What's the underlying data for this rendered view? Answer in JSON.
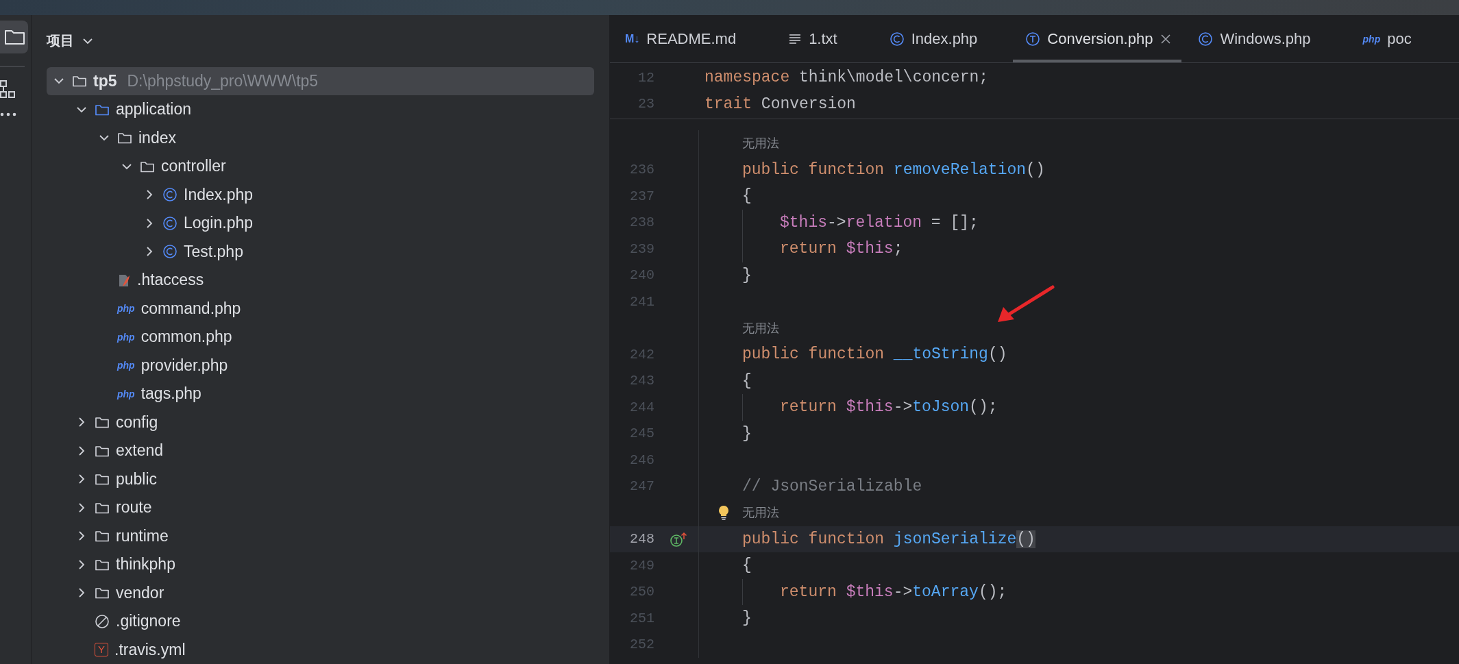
{
  "project_panel": {
    "title": "项目",
    "tree": [
      {
        "name": "tp5",
        "path": "D:\\phpstudy_pro\\WWW\\tp5",
        "kind": "folder",
        "expanded": true,
        "selected": true,
        "children": [
          {
            "name": "application",
            "kind": "source_folder",
            "expanded": true,
            "selected": false,
            "children": [
              {
                "name": "index",
                "kind": "folder",
                "expanded": true,
                "selected": false,
                "children": [
                  {
                    "name": "controller",
                    "kind": "folder",
                    "expanded": true,
                    "selected": false,
                    "children": [
                      {
                        "name": "Index.php",
                        "kind": "class",
                        "expanded": false,
                        "selected": false
                      },
                      {
                        "name": "Login.php",
                        "kind": "class",
                        "expanded": false,
                        "selected": false
                      },
                      {
                        "name": "Test.php",
                        "kind": "class",
                        "expanded": false,
                        "selected": false
                      }
                    ]
                  }
                ]
              },
              {
                "name": ".htaccess",
                "kind": "htaccess",
                "selected": false
              },
              {
                "name": "command.php",
                "kind": "php",
                "icon_text": "php",
                "selected": false
              },
              {
                "name": "common.php",
                "kind": "php",
                "icon_text": "php",
                "selected": false
              },
              {
                "name": "provider.php",
                "kind": "php",
                "icon_text": "php",
                "selected": false
              },
              {
                "name": "tags.php",
                "kind": "php",
                "icon_text": "php",
                "selected": false
              }
            ]
          },
          {
            "name": "config",
            "kind": "folder",
            "expanded": false,
            "selected": false
          },
          {
            "name": "extend",
            "kind": "folder",
            "expanded": false,
            "selected": false
          },
          {
            "name": "public",
            "kind": "folder",
            "expanded": false,
            "selected": false
          },
          {
            "name": "route",
            "kind": "folder",
            "expanded": false,
            "selected": false
          },
          {
            "name": "runtime",
            "kind": "folder",
            "expanded": false,
            "selected": false
          },
          {
            "name": "thinkphp",
            "kind": "folder",
            "expanded": false,
            "selected": false
          },
          {
            "name": "vendor",
            "kind": "folder",
            "expanded": false,
            "selected": false
          },
          {
            "name": ".gitignore",
            "kind": "ignore",
            "selected": false
          },
          {
            "name": ".travis.yml",
            "kind": "yaml",
            "icon_text": "Y",
            "selected": false
          }
        ]
      }
    ]
  },
  "editor": {
    "tabs": [
      {
        "label": "README.md",
        "kind": "markdown",
        "icon_text": "M↓",
        "selected": false
      },
      {
        "label": "1.txt",
        "kind": "text",
        "selected": false
      },
      {
        "label": "Index.php",
        "kind": "class",
        "selected": false
      },
      {
        "label": "Conversion.php",
        "kind": "trait",
        "selected": true
      },
      {
        "label": "Windows.php",
        "kind": "class",
        "selected": false
      },
      {
        "label": "poc",
        "kind": "php",
        "icon_text": "php",
        "selected": false
      }
    ],
    "sticky_lines": [
      {
        "number": "12",
        "tokens": [
          {
            "kind": "keyword",
            "text": "namespace "
          },
          {
            "kind": "plain",
            "text": "think\\model\\concern;"
          }
        ]
      },
      {
        "number": "23",
        "tokens": [
          {
            "kind": "keyword",
            "text": "trait "
          },
          {
            "kind": "plain",
            "text": "Conversion"
          }
        ]
      }
    ],
    "lines": [
      {
        "kind": "hint",
        "text": "无用法"
      },
      {
        "kind": "code",
        "number": "236",
        "current": false,
        "tokens": [
          {
            "kind": "keyword",
            "text": "public function "
          },
          {
            "kind": "function",
            "text": "removeRelation"
          },
          {
            "kind": "plain",
            "text": "()"
          }
        ]
      },
      {
        "kind": "code",
        "number": "237",
        "current": false,
        "tokens": [
          {
            "kind": "plain",
            "text": "{"
          }
        ]
      },
      {
        "kind": "nested_code",
        "number": "238",
        "current": false,
        "tokens": [
          {
            "kind": "variable",
            "text": "$this"
          },
          {
            "kind": "plain",
            "text": "->"
          },
          {
            "kind": "field",
            "text": "relation"
          },
          {
            "kind": "plain",
            "text": " = [];"
          }
        ]
      },
      {
        "kind": "nested_code",
        "number": "239",
        "current": false,
        "tokens": [
          {
            "kind": "keyword",
            "text": "return "
          },
          {
            "kind": "variable",
            "text": "$this"
          },
          {
            "kind": "plain",
            "text": ";"
          }
        ]
      },
      {
        "kind": "code",
        "number": "240",
        "current": false,
        "tokens": [
          {
            "kind": "plain",
            "text": "}"
          }
        ]
      },
      {
        "kind": "code",
        "number": "241",
        "current": false
      },
      {
        "kind": "hint",
        "text": "无用法"
      },
      {
        "kind": "code",
        "number": "242",
        "current": false,
        "tokens": [
          {
            "kind": "keyword",
            "text": "public function "
          },
          {
            "kind": "function",
            "text": "__toString"
          },
          {
            "kind": "plain",
            "text": "()"
          }
        ]
      },
      {
        "kind": "code",
        "number": "243",
        "current": false,
        "tokens": [
          {
            "kind": "plain",
            "text": "{"
          }
        ]
      },
      {
        "kind": "nested_code",
        "number": "244",
        "current": false,
        "tokens": [
          {
            "kind": "keyword",
            "text": "return "
          },
          {
            "kind": "variable",
            "text": "$this"
          },
          {
            "kind": "plain",
            "text": "->"
          },
          {
            "kind": "function",
            "text": "toJson"
          },
          {
            "kind": "plain",
            "text": "();"
          }
        ]
      },
      {
        "kind": "code",
        "number": "245",
        "current": false,
        "tokens": [
          {
            "kind": "plain",
            "text": "}"
          }
        ]
      },
      {
        "kind": "code",
        "number": "246",
        "current": false
      },
      {
        "kind": "code",
        "number": "247",
        "current": false,
        "tokens": [
          {
            "kind": "comment",
            "text": "// JsonSerializable"
          }
        ]
      },
      {
        "kind": "hint_with_bulb",
        "text": "无用法"
      },
      {
        "kind": "marked_code",
        "number": "248",
        "current": true,
        "tokens": [
          {
            "kind": "keyword",
            "text": "public function "
          },
          {
            "kind": "function",
            "text": "jsonSerialize"
          },
          {
            "kind": "brace_match",
            "text": "()"
          }
        ]
      },
      {
        "kind": "code",
        "number": "249",
        "current": false,
        "tokens": [
          {
            "kind": "plain",
            "text": "{"
          }
        ]
      },
      {
        "kind": "nested_code",
        "number": "250",
        "current": false,
        "tokens": [
          {
            "kind": "keyword",
            "text": "return "
          },
          {
            "kind": "variable",
            "text": "$this"
          },
          {
            "kind": "plain",
            "text": "->"
          },
          {
            "kind": "function",
            "text": "toArray"
          },
          {
            "kind": "plain",
            "text": "();"
          }
        ]
      },
      {
        "kind": "code",
        "number": "251",
        "current": false,
        "tokens": [
          {
            "kind": "plain",
            "text": "}"
          }
        ]
      },
      {
        "kind": "code",
        "number": "252",
        "current": false
      }
    ]
  }
}
